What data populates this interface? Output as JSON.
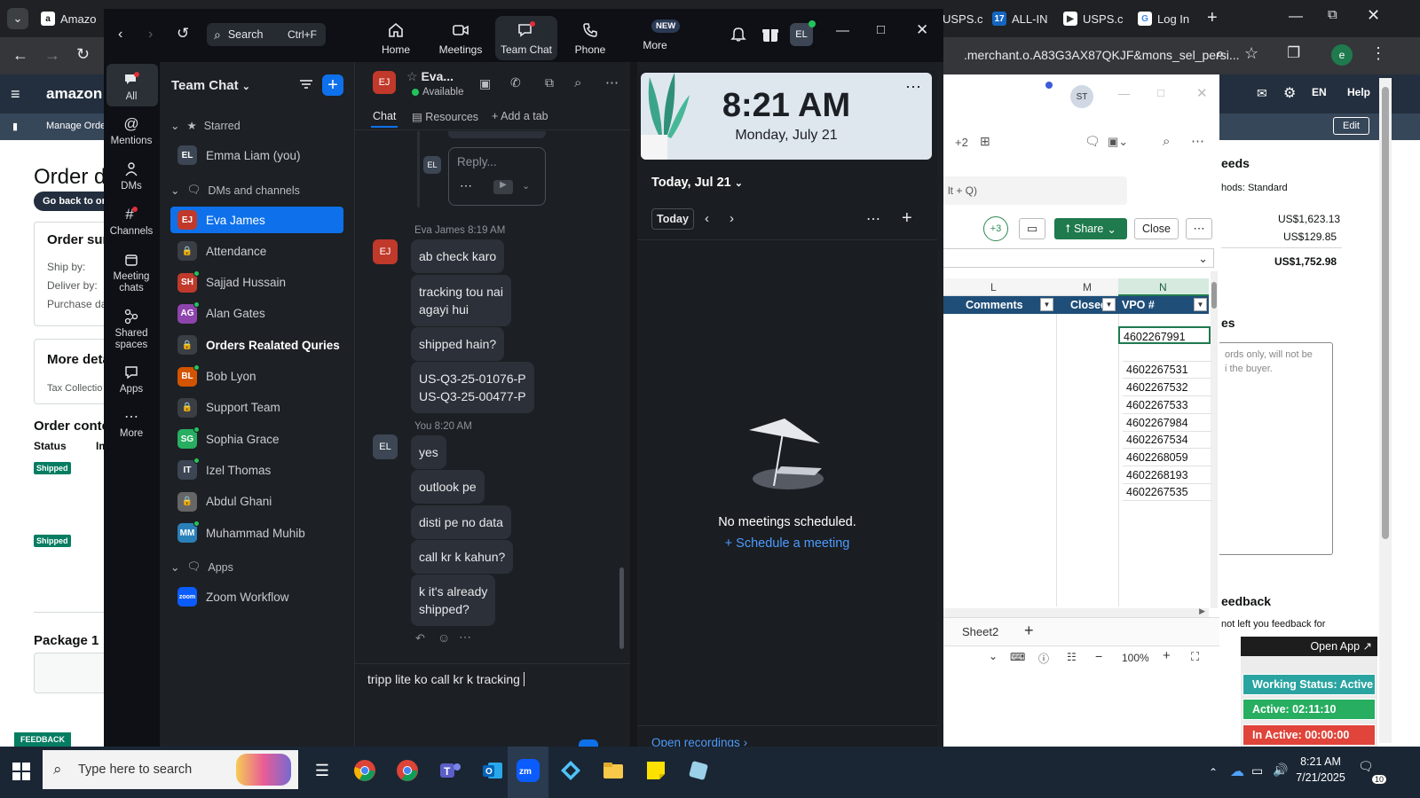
{
  "browser": {
    "tabs": [
      {
        "label": "Amazo",
        "icon": "amazon-icon"
      },
      {
        "label": "USPS.c",
        "icon": "usps-icon"
      },
      {
        "label": "ALL-IN",
        "icon": "tracking-17-icon"
      },
      {
        "label": "USPS.c",
        "icon": "usps-icon"
      },
      {
        "label": "Log In",
        "icon": "google-icon"
      }
    ],
    "address": ".merchant.o.A83G3AX87QKJF&mons_sel_persi...",
    "profile_initial": "e"
  },
  "amazon": {
    "logo": "amazon sel",
    "manage_orders": "Manage Order",
    "lang": "EN",
    "help": "Help",
    "edit": "Edit",
    "order_title": "Order de",
    "go_back": "Go back to ord",
    "order_summary": "Order sum",
    "ship_by": "Ship by:",
    "deliver_by": "Deliver by:",
    "purchase_date": "Purchase dat",
    "more_details": "More deta",
    "tax_collection": "Tax Collectio",
    "order_contents": "Order conte",
    "status_col": "Status",
    "im_col": "Im",
    "shipped_badge": "Shipped",
    "package": "Package 1",
    "feedback_tab": "FEEDBACK",
    "right": {
      "fees_title": "eeds",
      "methods": "hods: Standard",
      "amount1": "US$1,623.13",
      "amount2": "US$129.85",
      "total": "US$1,752.98",
      "notes_title": "es",
      "notes_text": "ords only, will not be\ni the buyer.",
      "feedback_title": "eedback",
      "feedback_text": "not left you feedback for"
    }
  },
  "excel": {
    "header_avatar": "ST",
    "collab_count": "+2",
    "search_hint": "lt + Q)",
    "participants": "+3",
    "share_label": "Share",
    "close_label": "Close",
    "col_letters": [
      "L",
      "M",
      "N"
    ],
    "headers": [
      "Comments",
      "Closed",
      "VPO #"
    ],
    "vpo_values": [
      "4602267991",
      "",
      "4602267531",
      "4602267532",
      "4602267533",
      "4602267984",
      "4602267534",
      "4602268059",
      "4602268193",
      "4602267535"
    ],
    "sheet_tab": "Sheet2",
    "zoom": "100%"
  },
  "zoom": {
    "search_label": "Search",
    "search_shortcut": "Ctrl+F",
    "nav": [
      {
        "label": "Home",
        "icon": "home-icon"
      },
      {
        "label": "Meetings",
        "icon": "video-icon"
      },
      {
        "label": "Team Chat",
        "icon": "chat-icon"
      },
      {
        "label": "Phone",
        "icon": "phone-icon"
      },
      {
        "label": "More",
        "icon": "more-icon",
        "badge": "NEW"
      }
    ],
    "user_initials": "EL",
    "rail": [
      {
        "label": "All"
      },
      {
        "label": "Mentions"
      },
      {
        "label": "DMs"
      },
      {
        "label": "Channels"
      },
      {
        "label": "Meeting chats"
      },
      {
        "label": "Shared spaces"
      },
      {
        "label": "Apps"
      },
      {
        "label": "More"
      }
    ],
    "list_title": "Team Chat",
    "sections": {
      "starred": "Starred",
      "dms": "DMs and channels",
      "apps": "Apps"
    },
    "starred": [
      {
        "initials": "EL",
        "name": "Emma Liam (you)",
        "color": "#3d4654"
      }
    ],
    "contacts": [
      {
        "initials": "EJ",
        "name": "Eva James",
        "color": "#c0392b",
        "active": true
      },
      {
        "initials": "",
        "name": "Attendance",
        "color": "#3a3e45"
      },
      {
        "initials": "SH",
        "name": "Sajjad Hussain",
        "color": "#c0392b"
      },
      {
        "initials": "AG",
        "name": "Alan Gates",
        "color": "#8e44ad"
      },
      {
        "initials": "",
        "name": "Orders Realated Quries",
        "color": "#3a3e45",
        "bold": true
      },
      {
        "initials": "BL",
        "name": "Bob Lyon",
        "color": "#d35400"
      },
      {
        "initials": "",
        "name": "Support Team",
        "color": "#3a3e45"
      },
      {
        "initials": "SG",
        "name": "Sophia Grace",
        "color": "#27ae60"
      },
      {
        "initials": "IT",
        "name": "Izel Thomas",
        "color": "#3d4654"
      },
      {
        "initials": "",
        "name": "Abdul Ghani",
        "color": "#666"
      },
      {
        "initials": "MM",
        "name": "Muhammad Muhib",
        "color": "#2980b9"
      }
    ],
    "apps": [
      {
        "initials": "zoom",
        "name": "Zoom Workflow",
        "color": "#0b5cff"
      }
    ],
    "chat": {
      "peer_initials": "EJ",
      "peer_name": "Eva...",
      "peer_status": "Available",
      "tabs": [
        "Chat",
        "Resources",
        "Add a tab"
      ],
      "reply_placeholder": "Reply...",
      "group1_meta": "Eva James 8:19 AM",
      "group1": [
        "ab check karo",
        "tracking tou nai\nagayi hui",
        "shipped hain?",
        "US-Q3-25-01076-P\nUS-Q3-25-00477-P"
      ],
      "group2_meta": "You 8:20 AM",
      "my_initials": "EL",
      "group2": [
        "yes",
        "outlook pe",
        "disti pe no data",
        "call kr k kahun?",
        "k it's already\nshipped?"
      ],
      "composer_text": "tripp lite ko call kr k tracking"
    },
    "calendar": {
      "time": "8:21 AM",
      "date": "Monday, July 21",
      "day_label": "Today, Jul 21",
      "today_btn": "Today",
      "empty": "No meetings scheduled.",
      "schedule": "Schedule a meeting",
      "open_recordings": "Open recordings"
    }
  },
  "side_tool": {
    "open_app": "Open App ↗",
    "working_status": "Working Status: Active",
    "active": "Active: 02:11:10",
    "inactive": "In Active: 00:00:00",
    "colors": {
      "status": "#2aa4a0",
      "active": "#27ae60",
      "inactive": "#e0443a"
    }
  },
  "taskbar": {
    "search_placeholder": "Type here to search",
    "time": "8:21 AM",
    "date": "7/21/2025",
    "notif_count": "10"
  }
}
